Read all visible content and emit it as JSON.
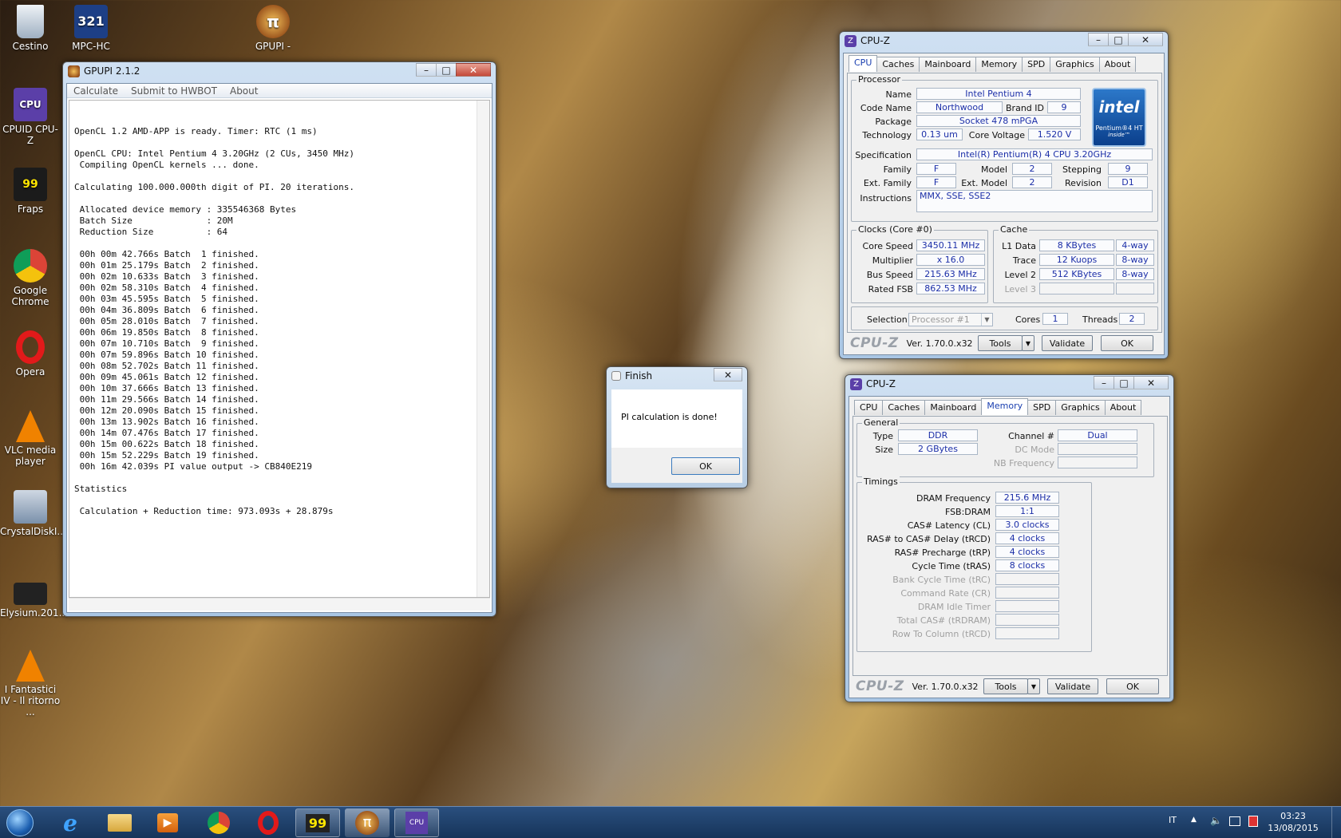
{
  "desktop_icons": [
    {
      "label": "Cestino",
      "icon": "recycle-bin-icon"
    },
    {
      "label": "MPC-HC",
      "icon": "mpc-hc-icon"
    },
    {
      "label": "GPUPI -",
      "icon": "gpupi-icon"
    },
    {
      "label": "CPUID CPU-Z",
      "icon": "cpuz-icon"
    },
    {
      "label": "Fraps",
      "icon": "fraps-icon"
    },
    {
      "label": "Google Chrome",
      "icon": "chrome-icon"
    },
    {
      "label": "Opera",
      "icon": "opera-icon"
    },
    {
      "label": "VLC media player",
      "icon": "vlc-icon"
    },
    {
      "label": "CrystalDiskI...",
      "icon": "crystaldisk-icon"
    },
    {
      "label": "Elysium.201...",
      "icon": "video-file-icon"
    },
    {
      "label": "I Fantastici IV - Il ritorno ...",
      "icon": "vlc-icon"
    }
  ],
  "gpupi": {
    "title": "GPUPI 2.1.2",
    "menu": [
      "Calculate",
      "Submit to HWBOT",
      "About"
    ],
    "console": "OpenCL 1.2 AMD-APP is ready. Timer: RTC (1 ms)\n\nOpenCL CPU: Intel Pentium 4 3.20GHz (2 CUs, 3450 MHz)\n Compiling OpenCL kernels ... done.\n\nCalculating 100.000.000th digit of PI. 20 iterations.\n\n Allocated device memory : 335546368 Bytes\n Batch Size              : 20M\n Reduction Size          : 64\n\n 00h 00m 42.766s Batch  1 finished.\n 00h 01m 25.179s Batch  2 finished.\n 00h 02m 10.633s Batch  3 finished.\n 00h 02m 58.310s Batch  4 finished.\n 00h 03m 45.595s Batch  5 finished.\n 00h 04m 36.809s Batch  6 finished.\n 00h 05m 28.010s Batch  7 finished.\n 00h 06m 19.850s Batch  8 finished.\n 00h 07m 10.710s Batch  9 finished.\n 00h 07m 59.896s Batch 10 finished.\n 00h 08m 52.702s Batch 11 finished.\n 00h 09m 45.061s Batch 12 finished.\n 00h 10m 37.666s Batch 13 finished.\n 00h 11m 29.566s Batch 14 finished.\n 00h 12m 20.090s Batch 15 finished.\n 00h 13m 13.902s Batch 16 finished.\n 00h 14m 07.476s Batch 17 finished.\n 00h 15m 00.622s Batch 18 finished.\n 00h 15m 52.229s Batch 19 finished.\n 00h 16m 42.039s PI value output -> CB840E219\n\nStatistics\n\n Calculation + Reduction time: 973.093s + 28.879s"
  },
  "dialog": {
    "title": "Finish",
    "message": "PI calculation is done!",
    "ok": "OK"
  },
  "cpuz_cpu": {
    "title": "CPU-Z",
    "tabs": [
      "CPU",
      "Caches",
      "Mainboard",
      "Memory",
      "SPD",
      "Graphics",
      "About"
    ],
    "processor_group": "Processor",
    "labels": {
      "name": "Name",
      "codename": "Code Name",
      "brandid": "Brand ID",
      "package": "Package",
      "technology": "Technology",
      "corevoltage": "Core Voltage",
      "specification": "Specification",
      "family": "Family",
      "model": "Model",
      "stepping": "Stepping",
      "extfamily": "Ext. Family",
      "extmodel": "Ext. Model",
      "revision": "Revision",
      "instructions": "Instructions"
    },
    "values": {
      "name": "Intel Pentium 4",
      "codename": "Northwood",
      "brandid": "9",
      "package": "Socket 478 mPGA",
      "technology": "0.13 um",
      "corevoltage": "1.520 V",
      "specification": "Intel(R) Pentium(R) 4 CPU 3.20GHz",
      "family": "F",
      "model": "2",
      "stepping": "9",
      "extfamily": "F",
      "extmodel": "2",
      "revision": "D1",
      "instructions": "MMX, SSE, SSE2"
    },
    "intel_logo": {
      "brand": "intel",
      "line1": "Pentium®4 HT",
      "line2": "inside™"
    },
    "clocks_group": "Clocks (Core #0)",
    "clocks": [
      {
        "label": "Core Speed",
        "value": "3450.11 MHz"
      },
      {
        "label": "Multiplier",
        "value": "x 16.0"
      },
      {
        "label": "Bus Speed",
        "value": "215.63 MHz"
      },
      {
        "label": "Rated FSB",
        "value": "862.53 MHz"
      }
    ],
    "cache_group": "Cache",
    "cache": [
      {
        "label": "L1 Data",
        "size": "8 KBytes",
        "way": "4-way"
      },
      {
        "label": "Trace",
        "size": "12 Kuops",
        "way": "8-way"
      },
      {
        "label": "Level 2",
        "size": "512 KBytes",
        "way": "8-way"
      },
      {
        "label": "Level 3",
        "size": "",
        "way": ""
      }
    ],
    "selection_label": "Selection",
    "selection_value": "Processor #1",
    "cores_label": "Cores",
    "cores": "1",
    "threads_label": "Threads",
    "threads": "2",
    "logo": "CPU-Z",
    "version": "Ver. 1.70.0.x32",
    "tools": "Tools",
    "validate": "Validate",
    "ok": "OK"
  },
  "cpuz_mem": {
    "title": "CPU-Z",
    "tabs": [
      "CPU",
      "Caches",
      "Mainboard",
      "Memory",
      "SPD",
      "Graphics",
      "About"
    ],
    "general_group": "General",
    "type_label": "Type",
    "type": "DDR",
    "size_label": "Size",
    "size": "2 GBytes",
    "channel_label": "Channel #",
    "channel": "Dual",
    "dcmode_label": "DC Mode",
    "nbfreq_label": "NB Frequency",
    "timings_group": "Timings",
    "timings": [
      {
        "label": "DRAM Frequency",
        "value": "215.6 MHz"
      },
      {
        "label": "FSB:DRAM",
        "value": "1:1"
      },
      {
        "label": "CAS# Latency (CL)",
        "value": "3.0 clocks"
      },
      {
        "label": "RAS# to CAS# Delay (tRCD)",
        "value": "4 clocks"
      },
      {
        "label": "RAS# Precharge (tRP)",
        "value": "4 clocks"
      },
      {
        "label": "Cycle Time (tRAS)",
        "value": "8 clocks"
      },
      {
        "label": "Bank Cycle Time (tRC)",
        "value": ""
      },
      {
        "label": "Command Rate (CR)",
        "value": ""
      },
      {
        "label": "DRAM Idle Timer",
        "value": ""
      },
      {
        "label": "Total CAS# (tRDRAM)",
        "value": ""
      },
      {
        "label": "Row To Column (tRCD)",
        "value": ""
      }
    ],
    "logo": "CPU-Z",
    "version": "Ver. 1.70.0.x32",
    "tools": "Tools",
    "validate": "Validate",
    "ok": "OK"
  },
  "taskbar": {
    "pinned": [
      "start-orb-icon",
      "internet-explorer-icon",
      "explorer-icon",
      "media-player-icon",
      "chrome-icon",
      "opera-icon",
      "fraps-icon",
      "gpupi-icon",
      "cpuz-icon"
    ],
    "language": "IT",
    "time": "03:23",
    "date": "13/08/2015"
  },
  "colors": {
    "accent_value": "#1c2fa8",
    "taskbar": "#1e4170"
  }
}
